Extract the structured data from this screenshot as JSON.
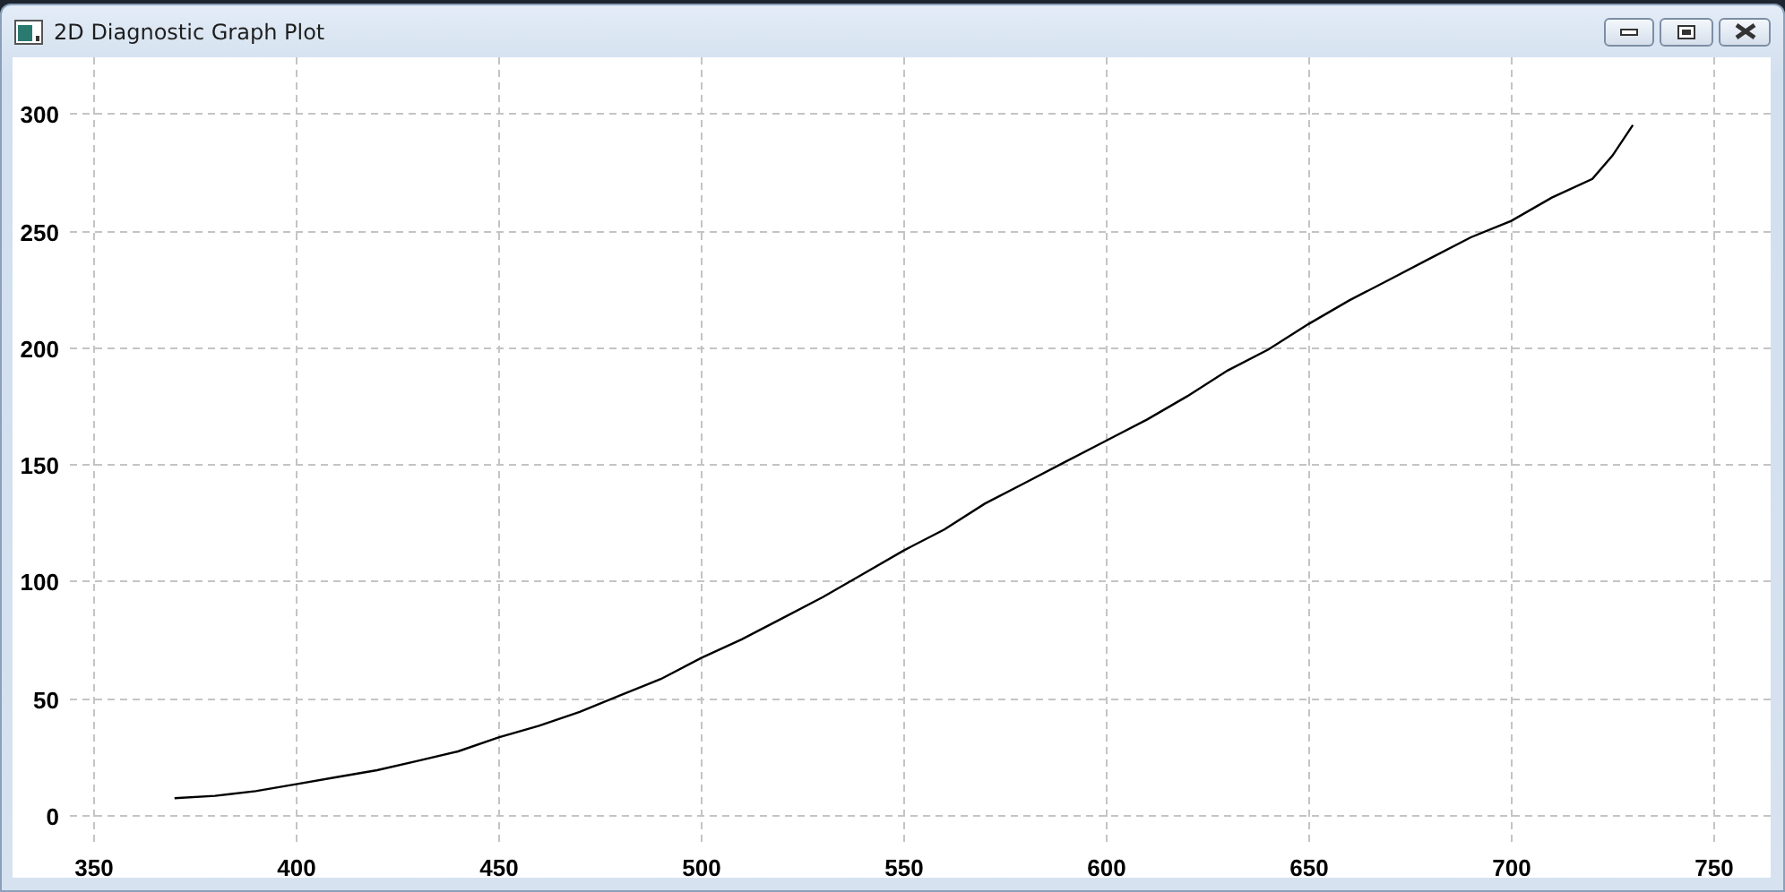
{
  "window": {
    "title": "2D Diagnostic Graph Plot",
    "buttons": [
      {
        "kind": "minimize"
      },
      {
        "kind": "restore"
      },
      {
        "kind": "close"
      }
    ]
  },
  "plot": {
    "chart_data": {
      "type": "line",
      "grid": true,
      "xlim": [
        330,
        764
      ],
      "ylim": [
        -27,
        324
      ],
      "xticks": [
        350,
        400,
        450,
        500,
        550,
        600,
        650,
        700,
        750
      ],
      "yticks": [
        0,
        50,
        100,
        150,
        200,
        250,
        300
      ],
      "series": [
        {
          "color": "#000000",
          "x": [
            370,
            380,
            390,
            400,
            410,
            420,
            430,
            440,
            450,
            460,
            470,
            480,
            490,
            500,
            510,
            520,
            530,
            540,
            550,
            560,
            570,
            580,
            590,
            600,
            610,
            620,
            630,
            640,
            650,
            660,
            670,
            680,
            690,
            700,
            710,
            720,
            725,
            730
          ],
          "values": [
            7,
            8,
            10,
            13,
            16,
            19,
            23,
            27,
            33,
            38,
            44,
            51,
            58,
            67,
            75,
            84,
            93,
            103,
            113,
            122,
            133,
            142,
            151,
            160,
            169,
            179,
            190,
            199,
            210,
            220,
            229,
            238,
            247,
            254,
            264,
            272,
            282,
            295
          ]
        }
      ]
    }
  }
}
